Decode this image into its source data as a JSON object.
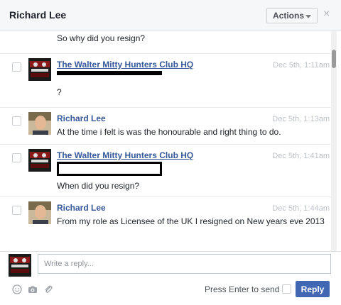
{
  "header": {
    "title": "Richard Lee",
    "actions_label": "Actions",
    "close_glyph": "×"
  },
  "messages": [
    {
      "sender": "",
      "time": "",
      "text": "So why did you resign?",
      "avatar": "none"
    },
    {
      "sender": "The Walter Mitty Hunters Club HQ",
      "time": "Dec 5th, 1:11am",
      "text": "?",
      "avatar": "club-logo"
    },
    {
      "sender": "Richard Lee",
      "time": "Dec 5th, 1:13am",
      "text": "At the time i felt is was the honourable and right thing to do.",
      "avatar": "person-photo"
    },
    {
      "sender": "The Walter Mitty Hunters Club HQ",
      "time": "Dec 5th, 1:41am",
      "text": "When did you resign?",
      "avatar": "club-logo"
    },
    {
      "sender": "Richard Lee",
      "time": "Dec 5th, 1:44am",
      "text": "From my role as Licensee of the UK I resigned on New years eve 2013",
      "avatar": "person-photo"
    }
  ],
  "reply": {
    "placeholder": "Write a reply...",
    "press_enter_label": "Press Enter to send",
    "reply_label": "Reply"
  },
  "icons": [
    "emoji-icon",
    "camera-icon",
    "attach-icon",
    "chevron-down-icon",
    "close-icon"
  ],
  "colors": {
    "link": "#365899",
    "reply_button": "#4267b2",
    "header_bg": "#f6f7f9"
  }
}
